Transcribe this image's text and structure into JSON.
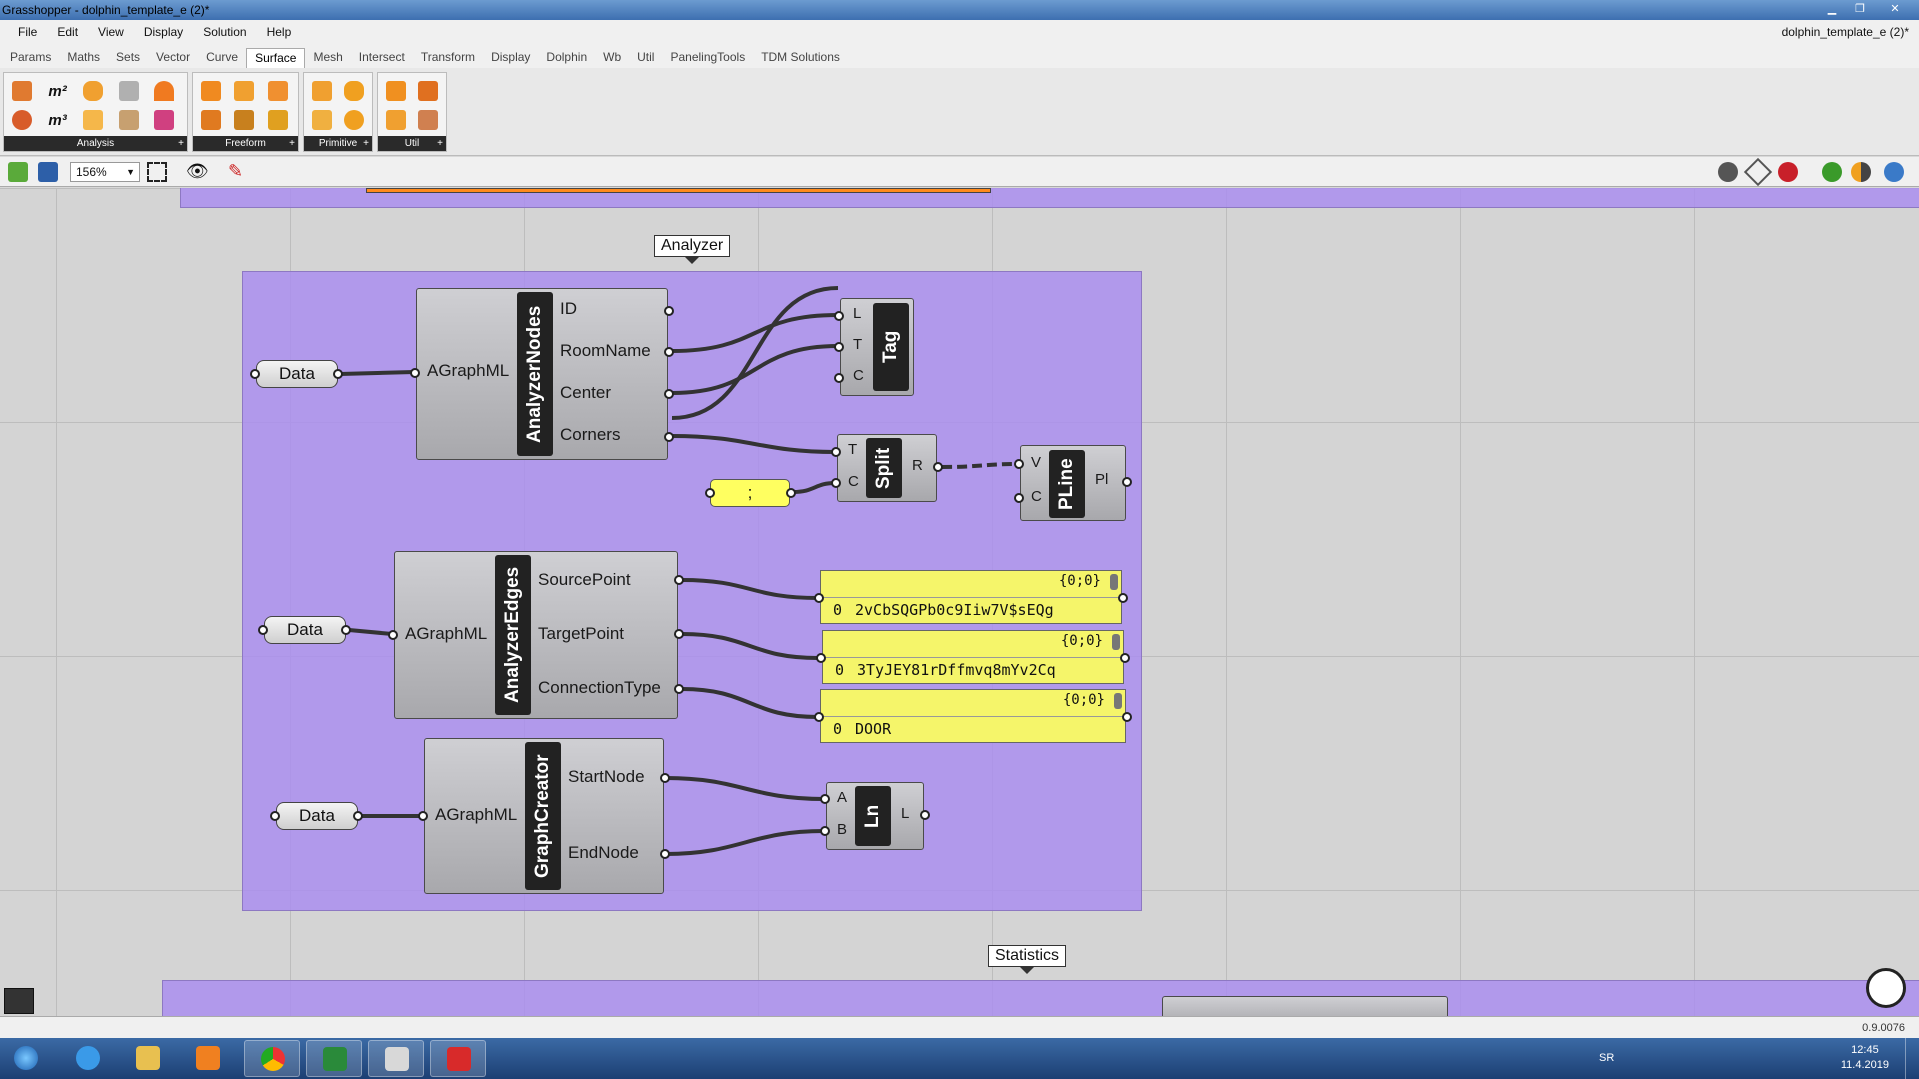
{
  "window": {
    "title": "Grasshopper - dolphin_template_e (2)*",
    "doc_name": "dolphin_template_e (2)*"
  },
  "menu": [
    "File",
    "Edit",
    "View",
    "Display",
    "Solution",
    "Help"
  ],
  "tabs": [
    "Params",
    "Maths",
    "Sets",
    "Vector",
    "Curve",
    "Surface",
    "Mesh",
    "Intersect",
    "Transform",
    "Display",
    "Dolphin",
    "Wb",
    "Util",
    "PanelingTools",
    "TDM Solutions"
  ],
  "active_tab": "Surface",
  "ribbon_panels": [
    "Analysis",
    "Freeform",
    "Primitive",
    "Util"
  ],
  "ribbon_icons": {
    "m2": "m²",
    "m3": "m³"
  },
  "zoom": "156%",
  "groups": {
    "analyzer": "Analyzer",
    "statistics": "Statistics"
  },
  "data_param": "Data",
  "analyzer_nodes": {
    "input": "AGraphML",
    "nickname": "AnalyzerNodes",
    "outputs": [
      "ID",
      "RoomName",
      "Center",
      "Corners"
    ]
  },
  "tag": {
    "nickname": "Tag",
    "inputs": [
      "L",
      "T",
      "C"
    ]
  },
  "split": {
    "nickname": "Split",
    "inputs": [
      "T",
      "C"
    ],
    "output": "R",
    "separator": ";"
  },
  "pline": {
    "nickname": "PLine",
    "inputs": [
      "V",
      "C"
    ],
    "output": "Pl"
  },
  "analyzer_edges": {
    "input": "AGraphML",
    "nickname": "AnalyzerEdges",
    "outputs": [
      "SourcePoint",
      "TargetPoint",
      "ConnectionType"
    ]
  },
  "panels": [
    {
      "header": "{0;0}",
      "index": "0",
      "value": "2vCbSQGPb0c9Iiw7V$sEQg"
    },
    {
      "header": "{0;0}",
      "index": "0",
      "value": "3TyJEY81rDffmvq8mYv2Cq"
    },
    {
      "header": "{0;0}",
      "index": "0",
      "value": "DOOR"
    }
  ],
  "graph_creator": {
    "input": "AGraphML",
    "nickname": "GraphCreator",
    "outputs": [
      "StartNode",
      "EndNode"
    ]
  },
  "line": {
    "nickname": "Ln",
    "inputs": [
      "A",
      "B"
    ],
    "output": "L"
  },
  "status": {
    "version": "0.9.0076"
  },
  "tray": {
    "lang": "SR",
    "time": "12:45",
    "date": "11.4.2019"
  },
  "colors": {
    "group": "#aa8cf0",
    "panel": "#f5f56a",
    "orange": "#ff8a1c"
  }
}
